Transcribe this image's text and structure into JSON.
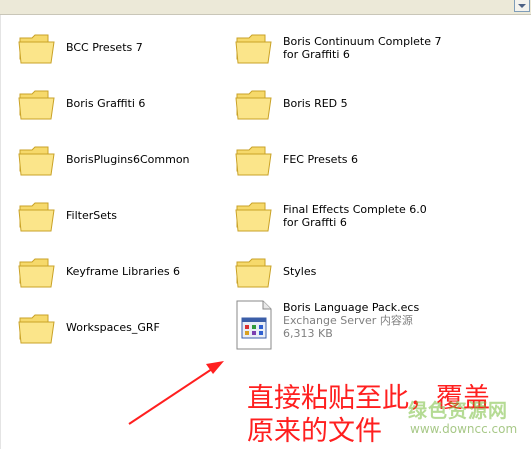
{
  "items": [
    {
      "name": "BCC Presets 7",
      "type": "folder"
    },
    {
      "name": "Boris Continuum Complete 7 for Graffiti 6",
      "type": "folder"
    },
    {
      "name": "Boris Graffiti 6",
      "type": "folder"
    },
    {
      "name": "Boris RED 5",
      "type": "folder"
    },
    {
      "name": "BorisPlugins6Common",
      "type": "folder"
    },
    {
      "name": "FEC Presets 6",
      "type": "folder"
    },
    {
      "name": "FilterSets",
      "type": "folder"
    },
    {
      "name": "Final Effects Complete 6.0 for Graffti 6",
      "type": "folder"
    },
    {
      "name": "Keyframe Libraries 6",
      "type": "folder"
    },
    {
      "name": "Styles",
      "type": "folder"
    },
    {
      "name": "Workspaces_GRF",
      "type": "folder"
    },
    {
      "name": "Boris Language Pack.ecs",
      "type": "file",
      "kind": "Exchange Server 内容源",
      "size": "6,313 KB"
    }
  ],
  "annotation": {
    "line1": "直接粘贴至此，覆盖",
    "line2": "原来的文件",
    "color": "#ff1f1f"
  },
  "watermark": {
    "brand": "绿色资源网",
    "url": "www.downcc.com"
  },
  "colors": {
    "folder_fill": "#f6d96b",
    "folder_border": "#c9a227"
  }
}
